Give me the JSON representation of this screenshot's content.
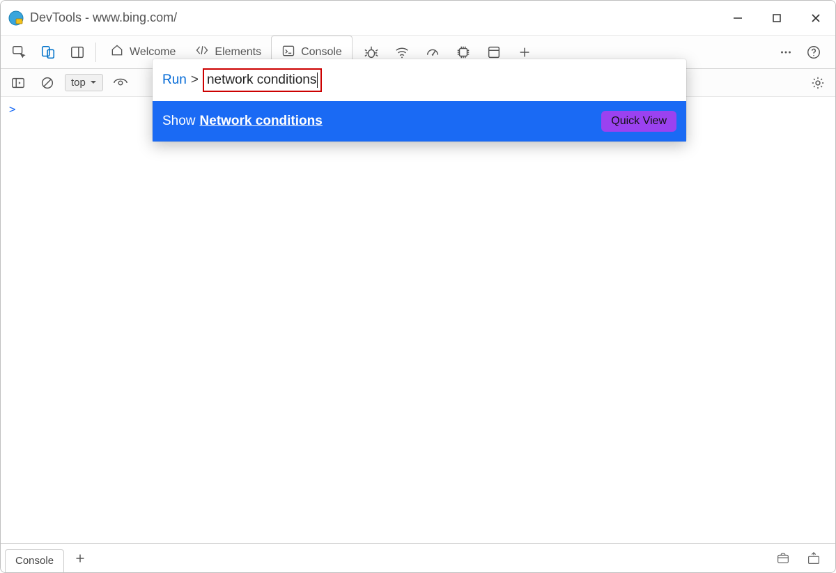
{
  "window": {
    "title": "DevTools - www.bing.com/"
  },
  "tabs": {
    "welcome": "Welcome",
    "elements": "Elements",
    "console": "Console"
  },
  "console_bar": {
    "context": "top"
  },
  "command_menu": {
    "run_label": "Run",
    "prompt_symbol": ">",
    "query": "network conditions",
    "result_prefix": "Show",
    "result_term": "Network conditions",
    "result_badge": "Quick View"
  },
  "console_body": {
    "prompt_symbol": ">"
  },
  "drawer": {
    "tab_console": "Console"
  }
}
